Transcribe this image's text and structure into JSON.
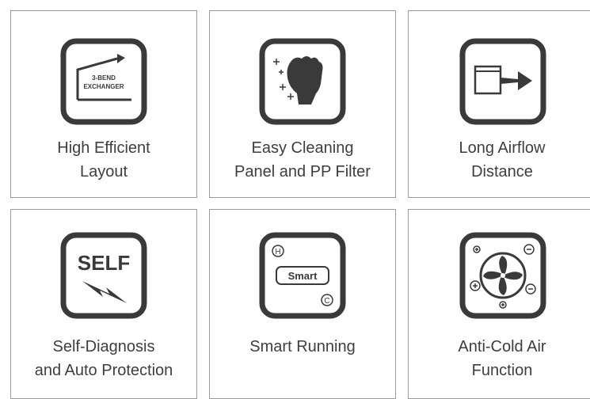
{
  "features": [
    {
      "id": "high-efficient-layout",
      "icon": "three-bend-exchanger-icon",
      "icon_text": [
        "3-BEND",
        "EXCHANGER"
      ],
      "lines": [
        "High Efficient",
        "Layout"
      ]
    },
    {
      "id": "easy-cleaning",
      "icon": "cleaning-hand-icon",
      "lines": [
        "Easy Cleaning",
        "Panel and PP Filter"
      ]
    },
    {
      "id": "long-airflow",
      "icon": "airflow-arrow-icon",
      "lines": [
        "Long Airflow",
        "Distance"
      ]
    },
    {
      "id": "self-diagnosis",
      "icon": "self-diagnosis-icon",
      "icon_text": [
        "SELF"
      ],
      "lines": [
        "Self-Diagnosis",
        "and Auto Protection"
      ]
    },
    {
      "id": "smart-running",
      "icon": "smart-running-icon",
      "icon_text": [
        "H",
        "Smart",
        "C"
      ],
      "lines": [
        "Smart Running"
      ]
    },
    {
      "id": "anti-cold-air",
      "icon": "fan-icon",
      "lines": [
        "Anti-Cold Air",
        "Function"
      ]
    }
  ]
}
